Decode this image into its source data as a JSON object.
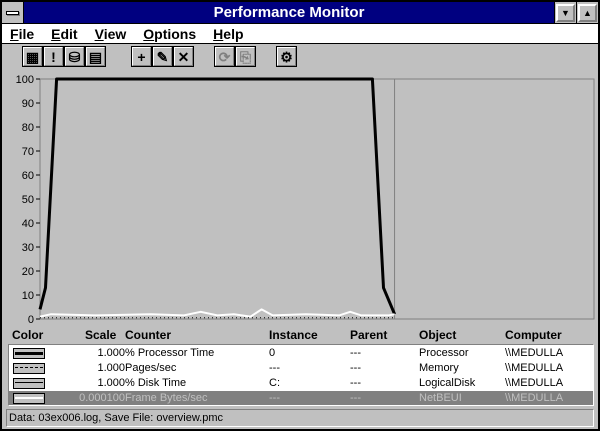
{
  "window": {
    "title": "Performance Monitor",
    "minimize_icon": "triangle-down-icon",
    "maximize_icon": "triangle-up-icon"
  },
  "menu": [
    {
      "label": "File",
      "key": "F",
      "rest": "ile"
    },
    {
      "label": "Edit",
      "key": "E",
      "rest": "dit"
    },
    {
      "label": "View",
      "key": "V",
      "rest": "iew"
    },
    {
      "label": "Options",
      "key": "O",
      "rest": "ptions"
    },
    {
      "label": "Help",
      "key": "H",
      "rest": "elp"
    }
  ],
  "toolbar": [
    {
      "name": "chart-view-icon",
      "glyph": "▦",
      "enabled": true
    },
    {
      "name": "alert-view-icon",
      "glyph": "!",
      "enabled": true
    },
    {
      "name": "log-view-icon",
      "glyph": "⛁",
      "enabled": true
    },
    {
      "name": "report-view-icon",
      "glyph": "▤",
      "enabled": true
    },
    {
      "name": "add-counter-icon",
      "glyph": "+",
      "enabled": true
    },
    {
      "name": "edit-counter-icon",
      "glyph": "✎",
      "enabled": true
    },
    {
      "name": "delete-counter-icon",
      "glyph": "✕",
      "enabled": true
    },
    {
      "name": "update-now-icon",
      "glyph": "⟳",
      "enabled": false
    },
    {
      "name": "bookmark-icon",
      "glyph": "⎘",
      "enabled": false
    },
    {
      "name": "options-icon",
      "glyph": "⚙",
      "enabled": true
    }
  ],
  "chart_data": {
    "type": "line",
    "ylim": [
      0,
      100
    ],
    "yticks": [
      "100",
      "90",
      "80",
      "70",
      "60",
      "50",
      "40",
      "30",
      "20",
      "10",
      "0"
    ],
    "grid": false,
    "series": [
      {
        "color": "#000000",
        "style": "solid",
        "width": 3,
        "values": [
          [
            0,
            4
          ],
          [
            1,
            13
          ],
          [
            3,
            100
          ],
          [
            60,
            100
          ],
          [
            62,
            13
          ],
          [
            64,
            2
          ]
        ]
      },
      {
        "color": "#ffffff",
        "style": "solid",
        "width": 2,
        "values": [
          [
            0,
            1
          ],
          [
            2,
            2
          ],
          [
            10,
            1.5
          ],
          [
            20,
            2
          ],
          [
            26,
            1.5
          ],
          [
            29,
            3
          ],
          [
            32,
            1.5
          ],
          [
            35,
            2
          ],
          [
            38,
            1
          ],
          [
            40,
            4
          ],
          [
            42,
            1.5
          ],
          [
            48,
            2
          ],
          [
            54,
            1.5
          ],
          [
            56,
            3
          ],
          [
            58,
            1.5
          ],
          [
            63,
            1.5
          ],
          [
            64,
            2
          ]
        ]
      },
      {
        "color": "#000000",
        "style": "dotted",
        "width": 1,
        "values": [
          [
            0,
            0.5
          ],
          [
            64,
            0.5
          ]
        ]
      }
    ],
    "x_max": 100
  },
  "legend": {
    "headers": {
      "color": "Color",
      "scale": "Scale",
      "counter": "Counter",
      "instance": "Instance",
      "parent": "Parent",
      "object": "Object",
      "computer": "Computer"
    },
    "rows": [
      {
        "line": "thick",
        "scale": "1.000",
        "counter": "% Processor Time",
        "instance": "0",
        "parent": "---",
        "object": "Processor",
        "computer": "\\\\MEDULLA",
        "selected": false
      },
      {
        "line": "dashed",
        "scale": "1.000",
        "counter": "Pages/sec",
        "instance": "---",
        "parent": "---",
        "object": "Memory",
        "computer": "\\\\MEDULLA",
        "selected": false
      },
      {
        "line": "thin",
        "scale": "1.000",
        "counter": "% Disk Time",
        "instance": "C:",
        "parent": "---",
        "object": "LogicalDisk",
        "computer": "\\\\MEDULLA",
        "selected": false
      },
      {
        "line": "white",
        "scale": "0.000100",
        "counter": "Frame Bytes/sec",
        "instance": "---",
        "parent": "---",
        "object": "NetBEUI",
        "computer": "\\\\MEDULLA",
        "selected": true
      }
    ]
  },
  "status": {
    "text": "Data: 03ex006.log, Save File: overview.pmc"
  }
}
